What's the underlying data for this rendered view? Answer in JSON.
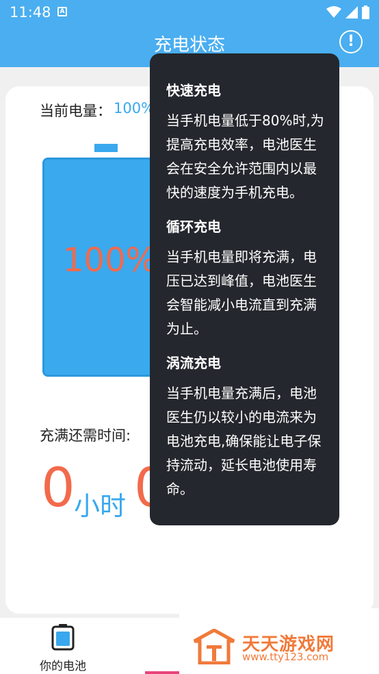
{
  "status_bar": {
    "time": "11:48",
    "notif_glyph": "A"
  },
  "app_bar": {
    "title": "充电状态",
    "info_glyph": "!"
  },
  "battery": {
    "current_label": "当前电量：",
    "current_value": "100%",
    "percent_text": "100%",
    "level": 1.0
  },
  "remaining": {
    "label": "充满还需时间:",
    "hours": "0",
    "hours_unit": "小时",
    "minutes": "0"
  },
  "bottom_nav": {
    "items": [
      {
        "label": "你的电池",
        "icon": "battery-icon"
      }
    ]
  },
  "popover": {
    "sections": [
      {
        "title": "快速充电",
        "body": "当手机电量低于80%时,为提高充电效率，电池医生会在安全允许范围内以最快的速度为手机充电。"
      },
      {
        "title": "循环充电",
        "body": "当手机电量即将充满，电压已达到峰值，电池医生会智能减小电流直到充满为止。"
      },
      {
        "title": "涡流充电",
        "body": "当手机电量充满后，电池医生仍以较小的电流来为电池充电,确保能让电子保持流动，延长电池使用寿命。"
      }
    ]
  },
  "watermark": {
    "title": "天天游戏网",
    "url": "www.tty123.com"
  },
  "colors": {
    "accent": "#4aaef0",
    "battery": "#3aa9ee",
    "highlight": "#f26a4b",
    "popover_bg": "#24272d"
  }
}
